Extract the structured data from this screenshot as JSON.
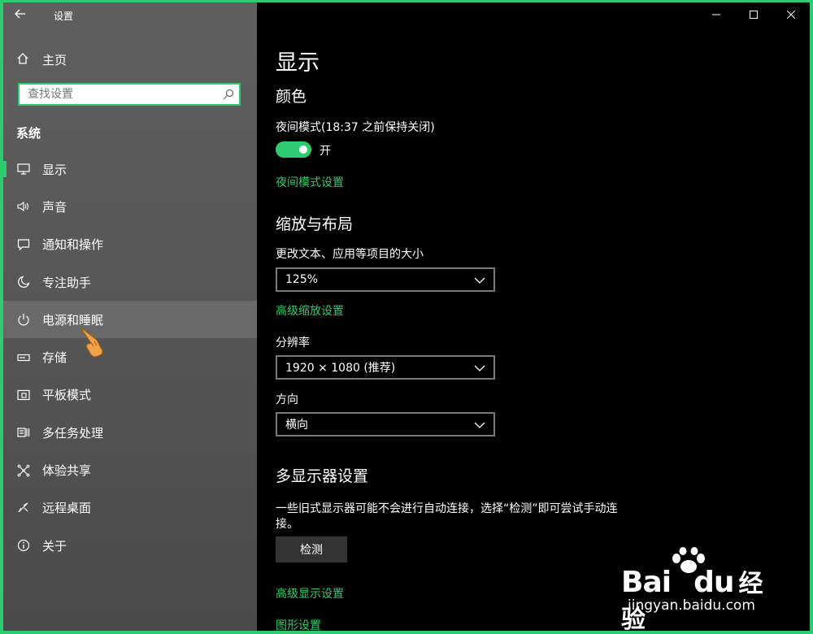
{
  "window": {
    "title": "设置",
    "controls": [
      "minimize",
      "maximize",
      "close"
    ]
  },
  "sidebar": {
    "home_label": "主页",
    "search_placeholder": "查找设置",
    "section": "系统",
    "items": [
      {
        "label": "显示",
        "icon": "monitor-icon",
        "selected": true
      },
      {
        "label": "声音",
        "icon": "speaker-icon"
      },
      {
        "label": "通知和操作",
        "icon": "notification-icon"
      },
      {
        "label": "专注助手",
        "icon": "moon-icon"
      },
      {
        "label": "电源和睡眠",
        "icon": "power-icon",
        "hovered": true
      },
      {
        "label": "存储",
        "icon": "storage-icon"
      },
      {
        "label": "平板模式",
        "icon": "tablet-icon"
      },
      {
        "label": "多任务处理",
        "icon": "multitask-icon"
      },
      {
        "label": "体验共享",
        "icon": "share-icon"
      },
      {
        "label": "远程桌面",
        "icon": "remote-desktop-icon"
      },
      {
        "label": "关于",
        "icon": "info-icon"
      }
    ]
  },
  "main": {
    "title": "显示",
    "color_section": {
      "heading": "颜色",
      "night_mode_label": "夜间模式(18:37 之前保持关闭)",
      "toggle_state": "开",
      "night_mode_link": "夜间模式设置"
    },
    "scale_section": {
      "heading": "缩放与布局",
      "scale_label": "更改文本、应用等项目的大小",
      "scale_value": "125%",
      "advanced_scale_link": "高级缩放设置",
      "resolution_label": "分辨率",
      "resolution_value": "1920 × 1080 (推荐)",
      "orientation_label": "方向",
      "orientation_value": "横向"
    },
    "multi_display": {
      "heading": "多显示器设置",
      "description_line1": "一些旧式显示器可能不会进行自动连接，选择“检测”即可尝试手动连",
      "description_line2": "接。",
      "detect_button": "检测",
      "advanced_display_link": "高级显示设置",
      "graphics_link": "图形设置"
    }
  },
  "watermark": {
    "brand": "Bai",
    "brand_tail": "du",
    "brand_cn": "经验",
    "domain": "jingyan.baidu.com"
  },
  "colors": {
    "accent": "#2ecc71",
    "sidebar_bg": "#5a5a5a",
    "main_bg": "#000000"
  }
}
